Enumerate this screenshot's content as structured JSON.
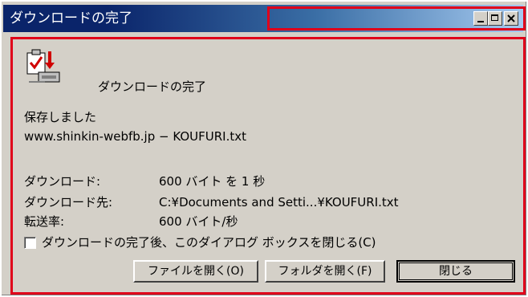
{
  "window": {
    "title": "ダウンロードの完了"
  },
  "titlebar_buttons": {
    "minimize_icon": "minimize-icon",
    "maximize_icon": "maximize-icon",
    "close_icon": "close-icon"
  },
  "content": {
    "icon": "download-complete-icon",
    "heading": "ダウンロードの完了",
    "saved_text": "保存しました",
    "source": "www.shinkin-webfb.jp − KOUFURI.txt"
  },
  "details": {
    "downloaded_label": "ダウンロード:",
    "downloaded_value": "600 バイト を 1 秒",
    "destination_label": "ダウンロード先:",
    "destination_value": "C:¥Documents and Setti...¥KOUFURI.txt",
    "rate_label": "転送率:",
    "rate_value": "600 バイト/秒"
  },
  "checkbox": {
    "label": "ダウンロードの完了後、このダイアログ ボックスを閉じる(C)",
    "checked": false
  },
  "buttons": {
    "open_file": "ファイルを開く(O)",
    "open_folder": "フォルダを開く(F)",
    "close": "閉じる"
  },
  "colors": {
    "titlebar_start": "#0a246a",
    "titlebar_end": "#a6caf0",
    "annotation_outline": "#e0001a"
  }
}
